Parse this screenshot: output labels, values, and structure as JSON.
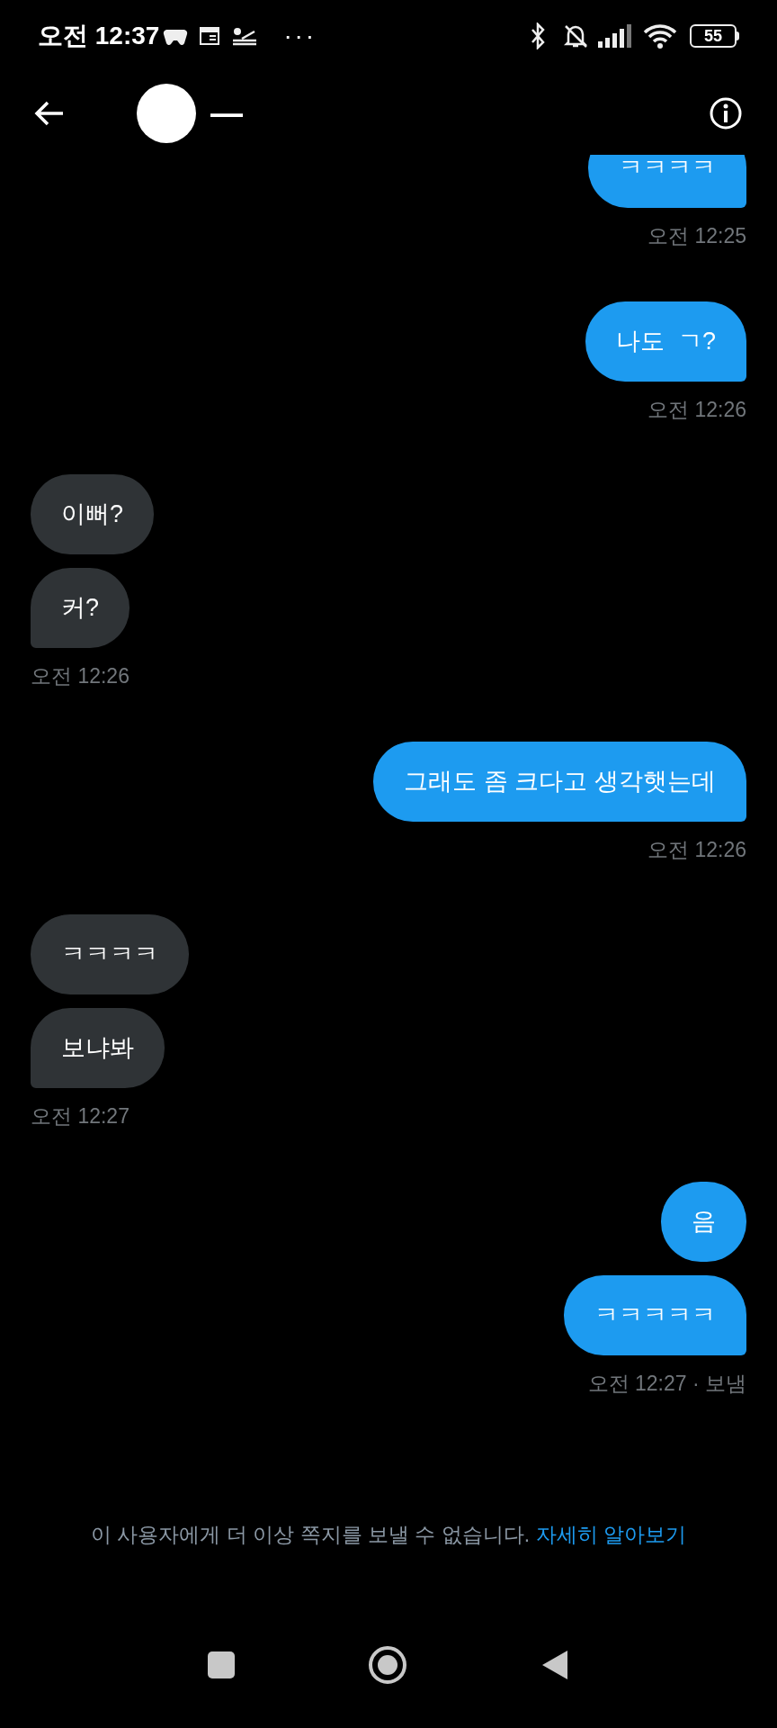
{
  "status_bar": {
    "time": "오전 12:37",
    "more": "···",
    "battery": "55"
  },
  "header": {
    "name": "—"
  },
  "messages": [
    {
      "kind": "bubble",
      "outgoing": true,
      "text": "ㅋㅋㅋㅋ",
      "tail": true
    },
    {
      "kind": "time",
      "outgoing": true,
      "text": "오전 12:25"
    },
    {
      "kind": "bubble",
      "outgoing": true,
      "text": "나도  ㄱ?",
      "tail": true
    },
    {
      "kind": "time",
      "outgoing": true,
      "text": "오전 12:26"
    },
    {
      "kind": "bubble",
      "outgoing": false,
      "text": "이뻐?",
      "tail": false
    },
    {
      "kind": "bubble",
      "outgoing": false,
      "text": "커?",
      "tail": true
    },
    {
      "kind": "time",
      "outgoing": false,
      "text": "오전 12:26"
    },
    {
      "kind": "bubble",
      "outgoing": true,
      "text": "그래도 좀 크다고 생각햇는데",
      "tail": true
    },
    {
      "kind": "time",
      "outgoing": true,
      "text": "오전 12:26"
    },
    {
      "kind": "bubble",
      "outgoing": false,
      "text": "ㅋㅋㅋㅋ",
      "tail": false
    },
    {
      "kind": "bubble",
      "outgoing": false,
      "text": "보냐봐",
      "tail": true
    },
    {
      "kind": "time",
      "outgoing": false,
      "text": "오전 12:27"
    },
    {
      "kind": "bubble",
      "outgoing": true,
      "text": "음",
      "tail": false
    },
    {
      "kind": "bubble",
      "outgoing": true,
      "text": "ㅋㅋㅋㅋㅋ",
      "tail": true
    },
    {
      "kind": "time",
      "outgoing": true,
      "text": "오전 12:27 · 보냄"
    }
  ],
  "notice": {
    "text": "이 사용자에게 더 이상 쪽지를 보낼 수 없습니다.",
    "link": "자세히 알아보기"
  }
}
